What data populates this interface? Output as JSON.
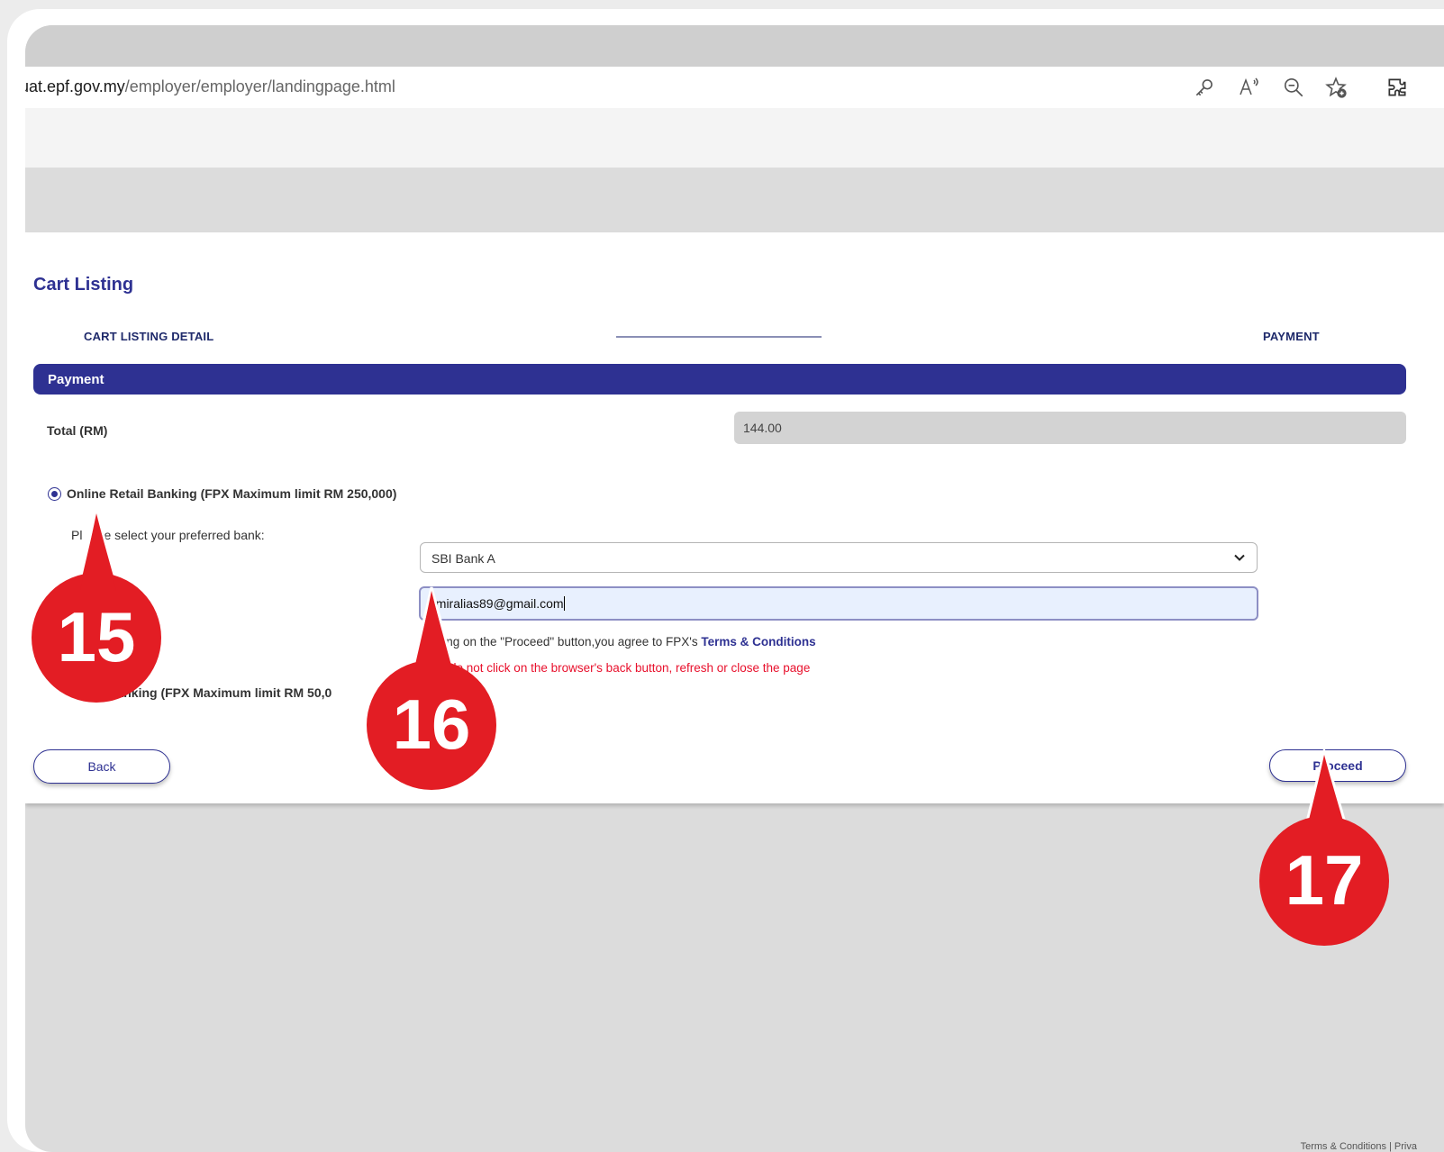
{
  "browser": {
    "url_host": "uat.epf.gov.my",
    "url_path": "/employer/employer/landingpage.html",
    "icons": [
      "key-icon",
      "read-aloud-icon",
      "zoom-out-icon",
      "favorites-add-icon",
      "extensions-icon"
    ]
  },
  "page": {
    "title": "Cart Listing",
    "steps": [
      "CART LISTING DETAIL",
      "PAYMENT"
    ],
    "section_title": "Payment"
  },
  "payment": {
    "total_label": "Total (RM)",
    "total_value": "144.00",
    "option_retail": "Online Retail Banking (FPX Maximum limit RM 250,000)",
    "option_corporate": "te Banking (FPX Maximum limit RM 50,0",
    "bank_prompt_a": "Pl",
    "bank_prompt_b": "e select your preferred bank:",
    "bank_selected": "SBI Bank A",
    "email_value": "amiralias89@gmail.com",
    "agree_text": "clicking on the \"Proceed\" button,you agree to FPX's",
    "agree_link": "Terms & Conditions",
    "warning_text": "ease do not click on the browser's back button, refresh or close the page"
  },
  "buttons": {
    "back": "Back",
    "proceed": "Proceed"
  },
  "callouts": [
    "15",
    "16",
    "17"
  ],
  "footer": "Terms & Conditions | Priva",
  "colors": {
    "brand": "#2e3192",
    "callout": "#e31d24",
    "warning": "#e8102c"
  }
}
